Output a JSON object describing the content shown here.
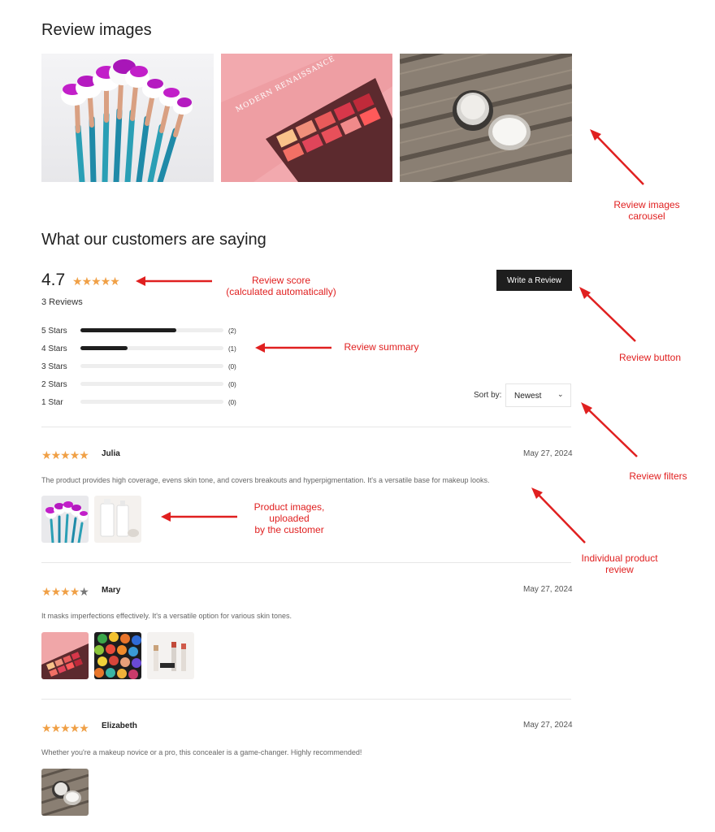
{
  "review_images": {
    "title": "Review images",
    "images": [
      "brushes-photo",
      "eyeshadow-palette-photo",
      "cream-jar-photo"
    ]
  },
  "summary": {
    "title": "What our customers are saying",
    "score": "4.7",
    "score_rating": 4.7,
    "review_count": "3 Reviews",
    "write_review_label": "Write a Review",
    "rows": [
      {
        "label": "5 Stars",
        "count": "(2)",
        "fraction": 0.67
      },
      {
        "label": "4 Stars",
        "count": "(1)",
        "fraction": 0.33
      },
      {
        "label": "3 Stars",
        "count": "(0)",
        "fraction": 0
      },
      {
        "label": "2 Stars",
        "count": "(0)",
        "fraction": 0
      },
      {
        "label": "1 Star",
        "count": "(0)",
        "fraction": 0
      }
    ],
    "sort_label": "Sort by:",
    "sort_value": "Newest"
  },
  "reviews": [
    {
      "name": "Julia",
      "rating": 5,
      "date": "May 27, 2024",
      "text": "The product provides high coverage, evens skin tone, and covers breakouts and hyperpigmentation. It's a versatile base for makeup looks."
    },
    {
      "name": "Mary",
      "rating": 4,
      "date": "May 27, 2024",
      "text": "It masks imperfections effectively. It's a versatile option for various skin tones."
    },
    {
      "name": "Elizabeth",
      "rating": 5,
      "date": "May 27, 2024",
      "text": "Whether you're a makeup novice or a pro, this concealer is a game-changer. Highly recommended!"
    }
  ],
  "annotations": {
    "carousel": "Review images\ncarousel",
    "score": "Review score\n(calculated automatically)",
    "review_button": "Review button",
    "summary": "Review summary",
    "filters": "Review filters",
    "product_images": "Product images,\nuploaded\nby the customer",
    "individual": "Individual product\nreview"
  },
  "colors": {
    "accent_star": "#f0a046",
    "annotation": "#e02020",
    "button_bg": "#1e1e1e"
  }
}
